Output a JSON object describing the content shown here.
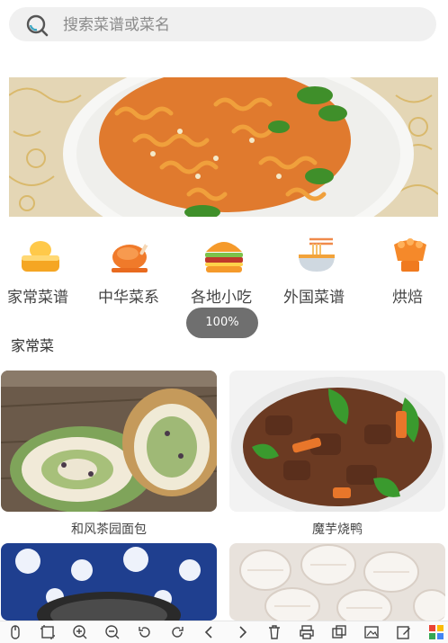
{
  "search": {
    "placeholder": "搜索菜谱或菜名"
  },
  "banner": {
    "image": "fried-noodles-with-cilantro-photo"
  },
  "categories": [
    {
      "label": "家常菜谱",
      "icon": "bread-bun-icon"
    },
    {
      "label": "中华菜系",
      "icon": "roast-chicken-icon"
    },
    {
      "label": "各地小吃",
      "icon": "burger-icon"
    },
    {
      "label": "外国菜谱",
      "icon": "noodle-bowl-icon"
    },
    {
      "label": "烘焙",
      "icon": "cake-icon"
    }
  ],
  "zoom": {
    "label": "100%"
  },
  "section": {
    "title": "家常菜"
  },
  "recipes": [
    {
      "name": "和风茶园面包",
      "image": "matcha-bread-roll-photo"
    },
    {
      "name": "魔芋烧鸭",
      "image": "braised-duck-with-peppers-photo"
    },
    {
      "name": "",
      "image": "blue-white-porcelain-dish-photo"
    },
    {
      "name": "",
      "image": "squid-rolls-photo"
    }
  ],
  "toolbar": {
    "icons": [
      "pointer-icon",
      "crop-icon",
      "zoom-in-icon",
      "zoom-out-icon",
      "rotate-left-icon",
      "rotate-right-icon",
      "previous-icon",
      "next-icon",
      "delete-icon",
      "print-icon",
      "copy-icon",
      "image-icon",
      "edit-icon",
      "grid-icon"
    ]
  }
}
